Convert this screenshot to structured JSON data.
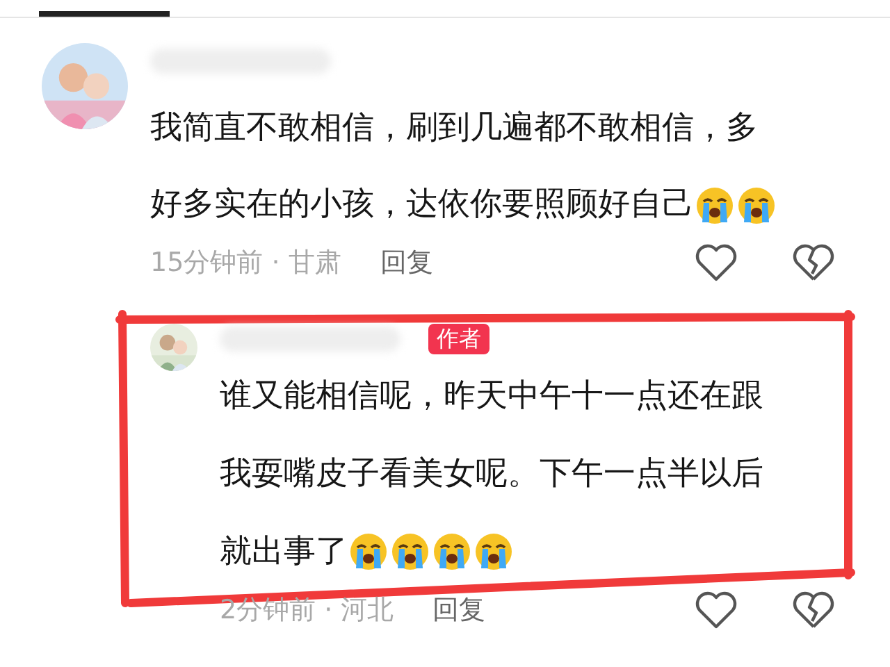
{
  "comments": [
    {
      "kind": "comment",
      "lines": [
        "我简直不敢相信，刷到几遍都不敢相信，多",
        "好多实在的小孩，达依你要照顾好自己"
      ],
      "emojis": [
        {
          "kind": "crying"
        },
        {
          "kind": "crying"
        }
      ],
      "time": "15分钟前 · 甘肃",
      "reply": "回复"
    },
    {
      "kind": "reply",
      "author_badge": "作者",
      "lines": [
        "谁又能相信呢，昨天中午十一点还在跟",
        "我耍嘴皮子看美女呢。下午一点半以后",
        "就出事了"
      ],
      "emojis": [
        {
          "kind": "crying"
        },
        {
          "kind": "crying"
        },
        {
          "kind": "crying"
        },
        {
          "kind": "crying"
        }
      ],
      "time": "2分钟前 · 河北",
      "reply": "回复"
    }
  ]
}
